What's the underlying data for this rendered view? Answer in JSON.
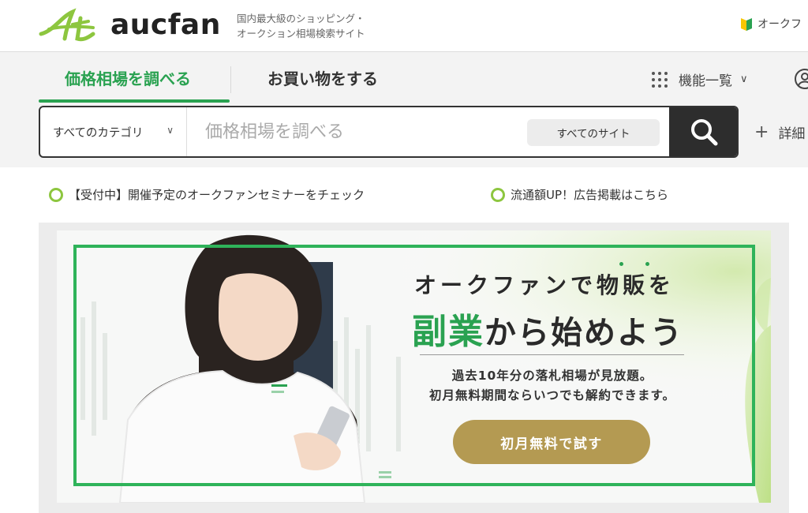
{
  "header": {
    "logo_text": "aucfan",
    "tagline_line1": "国内最大級のショッピング・",
    "tagline_line2": "オークション相場検索サイト",
    "beginner_link": "オークフ"
  },
  "tabs": {
    "price": "価格相場を調べる",
    "shop": "お買い物をする"
  },
  "features_menu": "機能一覧",
  "search": {
    "category": "すべてのカテゴリ",
    "placeholder": "価格相場を調べる",
    "site_filter": "すべてのサイト",
    "detail": "詳細"
  },
  "notices": [
    "【受付中】開催予定のオークファンセミナーをチェック",
    "流通額UP！広告掲載はこちら"
  ],
  "banner": {
    "title_line1": "オークファンで物販を",
    "title_green": "副業",
    "title_rest": "から始めよう",
    "sub_line1": "過去10年分の落札相場が見放題。",
    "sub_line2": "初月無料期間ならいつでも解約できます。",
    "cta": "初月無料で試す"
  },
  "colors": {
    "brand_green": "#2aa251",
    "cta_gold": "#b49a52",
    "search_button": "#2d2d2d"
  },
  "icons": [
    "logo-mark-icon",
    "beginner-mark-icon",
    "grid-menu-icon",
    "user-icon",
    "search-icon",
    "plus-icon",
    "chevron-down-icon"
  ]
}
